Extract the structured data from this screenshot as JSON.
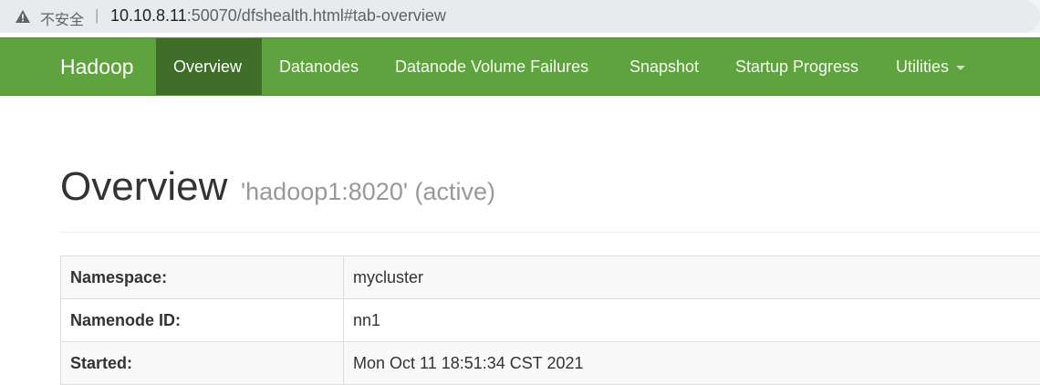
{
  "browser": {
    "security_label": "不安全",
    "url_host": "10.10.8.11",
    "url_rest": ":50070/dfshealth.html#tab-overview"
  },
  "navbar": {
    "brand": "Hadoop",
    "items": [
      {
        "label": "Overview",
        "active": true
      },
      {
        "label": "Datanodes",
        "active": false
      },
      {
        "label": "Datanode Volume Failures",
        "active": false
      },
      {
        "label": "Snapshot",
        "active": false
      },
      {
        "label": "Startup Progress",
        "active": false
      },
      {
        "label": "Utilities",
        "active": false
      }
    ],
    "colors": {
      "bar": "#5fa33e",
      "active": "#3e6e27"
    }
  },
  "header": {
    "title": "Overview",
    "subtitle": "'hadoop1:8020' (active)"
  },
  "overview_table": {
    "rows": [
      {
        "key": "Namespace:",
        "value": "mycluster"
      },
      {
        "key": "Namenode ID:",
        "value": "nn1"
      },
      {
        "key": "Started:",
        "value": "Mon Oct 11 18:51:34 CST 2021"
      }
    ]
  }
}
